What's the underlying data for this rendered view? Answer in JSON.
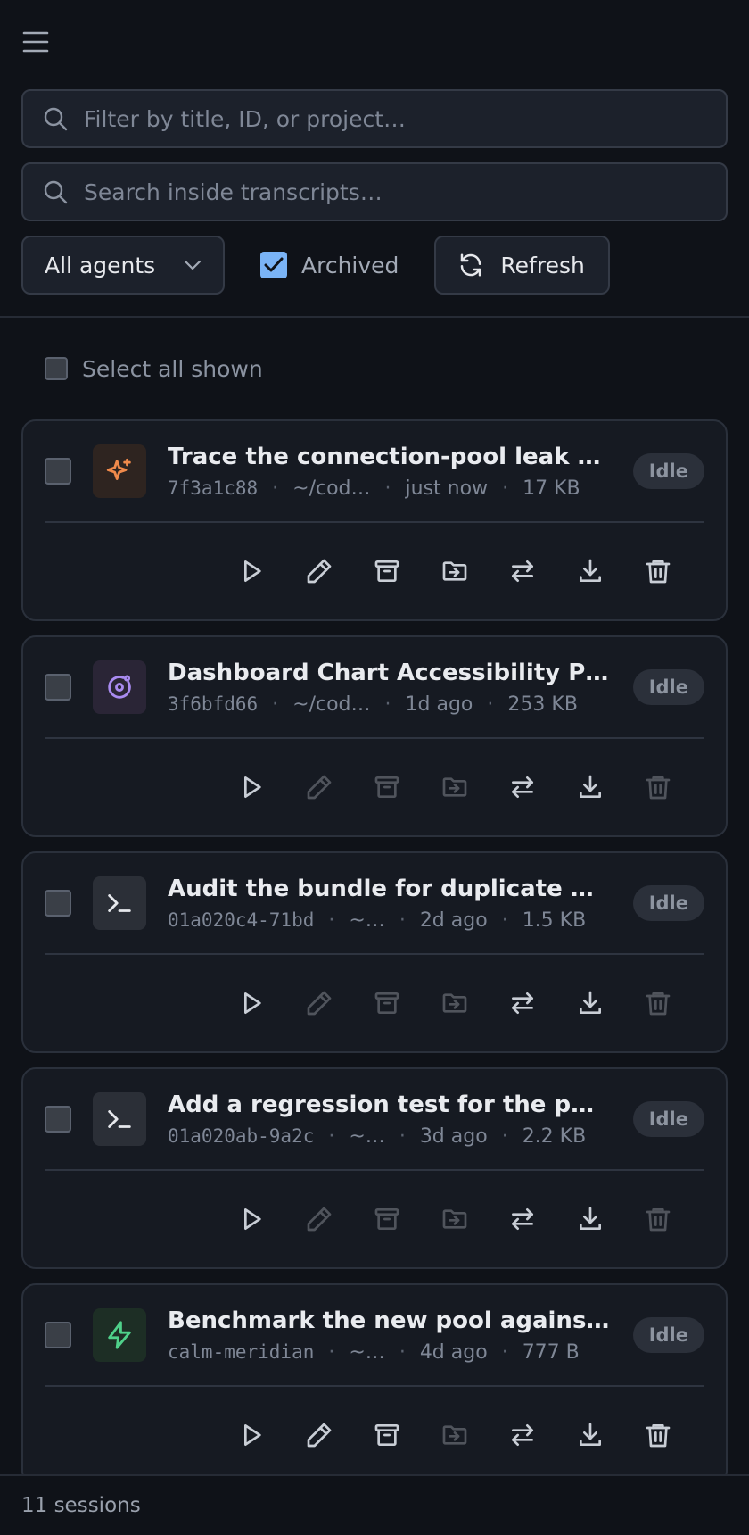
{
  "filter": {
    "placeholder": "Filter by title, ID, or project…"
  },
  "transcripts": {
    "placeholder": "Search inside transcripts…"
  },
  "agent_select": {
    "value": "All agents"
  },
  "archived": {
    "label": "Archived",
    "checked": true
  },
  "refresh": {
    "label": "Refresh"
  },
  "select_all": {
    "label": "Select all shown"
  },
  "sessions": [
    {
      "title": "Trace the connection-pool leak …",
      "id": "7f3a1c88",
      "project": "~/cod…",
      "time": "just now",
      "size": "17 KB",
      "status": "Idle",
      "icon": "sparkle-icon",
      "icon_color": "#f08a4b",
      "icon_bg": "#2e2420"
    },
    {
      "title": "Dashboard Chart Accessibility P…",
      "id": "3f6bfd66",
      "project": "~/cod…",
      "time": "1d ago",
      "size": "253 KB",
      "status": "Idle",
      "icon": "orbit-icon",
      "icon_color": "#a98bf0",
      "icon_bg": "#2a2536"
    },
    {
      "title": "Audit the bundle for duplicate …",
      "id": "01a020c4-71bd",
      "project": "~…",
      "time": "2d ago",
      "size": "1.5 KB",
      "status": "Idle",
      "icon": "terminal-icon",
      "icon_color": "#e6e8ec",
      "icon_bg": "#2b2f37"
    },
    {
      "title": "Add a regression test for the p…",
      "id": "01a020ab-9a2c",
      "project": "~…",
      "time": "3d ago",
      "size": "2.2 KB",
      "status": "Idle",
      "icon": "terminal-icon",
      "icon_color": "#e6e8ec",
      "icon_bg": "#2b2f37"
    },
    {
      "title": "Benchmark the new pool agains…",
      "id": "calm-meridian",
      "project": "~…",
      "time": "4d ago",
      "size": "777 B",
      "status": "Idle",
      "icon": "bolt-icon",
      "icon_color": "#4fd08a",
      "icon_bg": "#1d2e25"
    }
  ],
  "footer": {
    "count": "11 sessions"
  },
  "colors": {
    "accent": "#7ab3f5",
    "background": "#0f1218",
    "card": "#161a22"
  }
}
